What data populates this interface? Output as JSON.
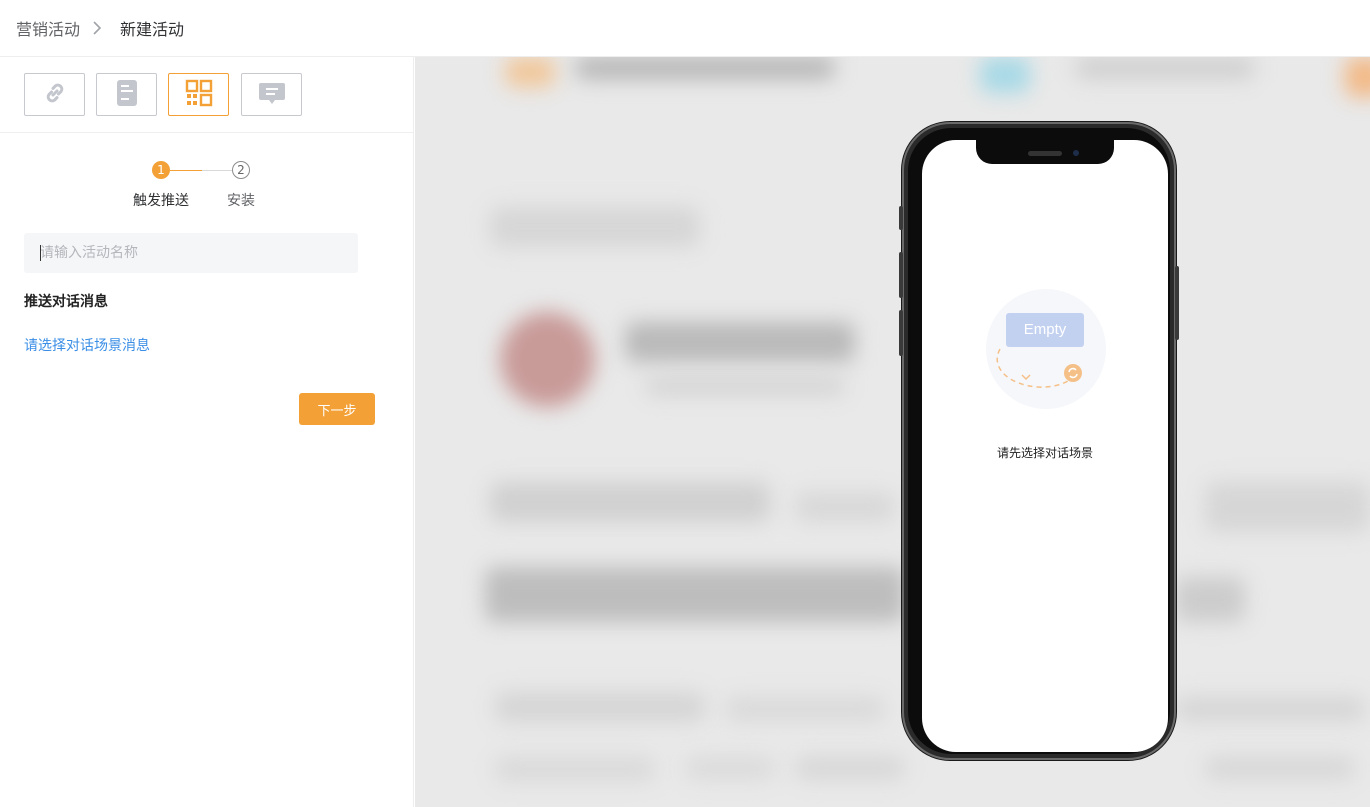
{
  "breadcrumb": {
    "parent": "营销活动",
    "current": "新建活动"
  },
  "toolbar": {
    "tools": [
      {
        "icon": "link-icon",
        "active": false
      },
      {
        "icon": "document-icon",
        "active": false
      },
      {
        "icon": "qrcode-icon",
        "active": true
      },
      {
        "icon": "message-icon",
        "active": false
      }
    ],
    "accent": "#f3a136"
  },
  "steps": {
    "items": [
      {
        "number": "1",
        "label": "触发推送",
        "active": true
      },
      {
        "number": "2",
        "label": "安装",
        "active": false
      }
    ]
  },
  "form": {
    "activity_name": {
      "value": "",
      "placeholder": "请输入活动名称"
    },
    "section_title": "推送对话消息",
    "select_link": "请选择对话场景消息",
    "next_button": "下一步"
  },
  "preview": {
    "empty_image_label": "Empty",
    "empty_text": "请先选择对话场景"
  },
  "colors": {
    "accent": "#f3a136",
    "link": "#3a8ee6",
    "empty_card": "#c3d1f1"
  }
}
